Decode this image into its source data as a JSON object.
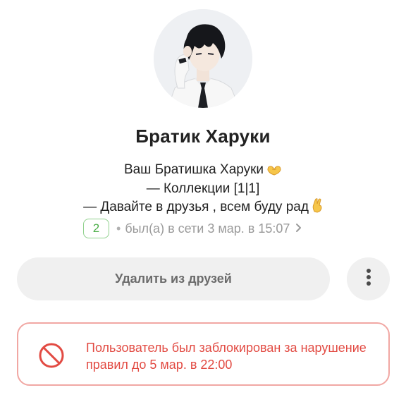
{
  "profile": {
    "name": "Братик Харуки",
    "status_lines": [
      "Ваш Братишка Харуки",
      "— Коллекции [1|1]",
      "— Давайте в друзья , всем буду рад"
    ],
    "status_emojis": [
      "heart-hands-emoji",
      "fingers-crossed-emoji"
    ],
    "mutual_friends_count": "2",
    "last_seen": "был(а) в сети 3 мар. в 15:07"
  },
  "actions": {
    "remove_friend_label": "Удалить из друзей",
    "more_icon": "more-vertical-icon"
  },
  "ban_notice": {
    "icon": "ban-icon",
    "text": "Пользователь был заблокирован за нарушение правил до 5 мар. в 22:00",
    "color": "#e24b43",
    "border_color": "#f1a7a3"
  },
  "colors": {
    "badge_green": "#4cae48",
    "button_bg": "#f0f0f0",
    "muted_text": "#9a9a9a"
  }
}
